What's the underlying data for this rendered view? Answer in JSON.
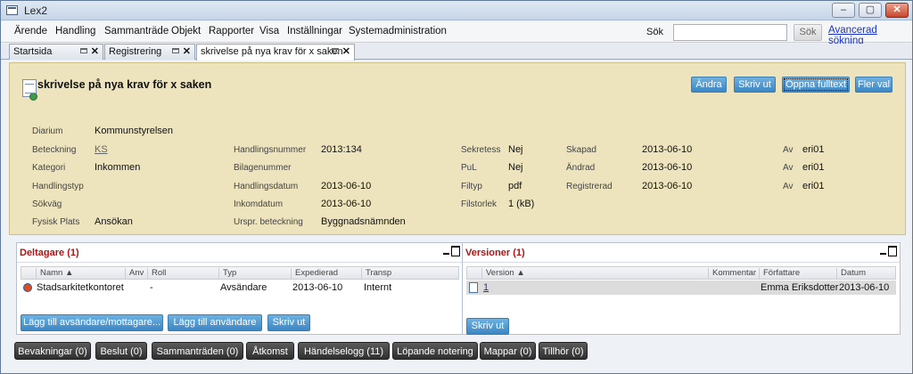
{
  "window": {
    "title": "Lex2"
  },
  "menu": {
    "items": [
      "Ärende",
      "Handling",
      "Sammanträde",
      "Objekt",
      "Rapporter",
      "Visa",
      "Inställningar",
      "Systemadministration"
    ],
    "search_label": "Sök",
    "search_value": "",
    "search_button": "Sök",
    "advanced_search": "Avancerad sökning"
  },
  "tabs": [
    {
      "label": "Startsida"
    },
    {
      "label": "Registrering"
    },
    {
      "label": "skrivelse på nya krav för x saken"
    }
  ],
  "detail": {
    "title": "skrivelse på nya krav för x saken",
    "buttons": {
      "edit": "Ändra",
      "print": "Skriv ut",
      "open_fulltext": "Öppna fulltext",
      "more": "Fler val"
    },
    "fields": {
      "diarium_label": "Diarium",
      "diarium": "Kommunstyrelsen",
      "beteckning_label": "Beteckning",
      "beteckning": "KS",
      "kategori_label": "Kategori",
      "kategori": "Inkommen",
      "handlingstyp_label": "Handlingstyp",
      "handlingstyp": "",
      "sokvag_label": "Sökväg",
      "sokvag": "",
      "fysisk_plats_label": "Fysisk Plats",
      "fysisk_plats": "Ansökan",
      "handlingsnummer_label": "Handlingsnummer",
      "handlingsnummer": "2013:134",
      "bilagenummer_label": "Bilagenummer",
      "bilagenummer": "",
      "handlingsdatum_label": "Handlingsdatum",
      "handlingsdatum": "2013-06-10",
      "inkomdatum_label": "Inkomdatum",
      "inkomdatum": "2013-06-10",
      "urspr_label": "Urspr. beteckning",
      "urspr": "Byggnadsnämnden",
      "sekretess_label": "Sekretess",
      "sekretess": "Nej",
      "pul_label": "PuL",
      "pul": "Nej",
      "filtyp_label": "Filtyp",
      "filtyp": "pdf",
      "filstorlek_label": "Filstorlek",
      "filstorlek": "1 (kB)",
      "skapad_label": "Skapad",
      "skapad": "2013-06-10",
      "andrad_label": "Ändrad",
      "andrad": "2013-06-10",
      "registrerad_label": "Registrerad",
      "registrerad": "2013-06-10",
      "av_label": "Av",
      "av_skapad": "eri01",
      "av_andrad": "eri01",
      "av_registrerad": "eri01"
    }
  },
  "deltagare": {
    "title": "Deltagare (1)",
    "columns": [
      "Namn",
      "Anv",
      "Roll",
      "Typ",
      "Expedierad",
      "Transp"
    ],
    "rows": [
      {
        "namn": "Stadsarkitetkontoret",
        "anv": "",
        "roll": "-",
        "typ": "Avsändare",
        "expedierad": "2013-06-10",
        "transp": "Internt"
      }
    ],
    "buttons": {
      "add_sender": "Lägg till avsändare/mottagare...",
      "add_user": "Lägg till användare",
      "print": "Skriv ut"
    }
  },
  "versioner": {
    "title": "Versioner (1)",
    "columns": [
      "Version",
      "Kommentar",
      "Författare",
      "Datum"
    ],
    "rows": [
      {
        "version": "1",
        "kommentar": "",
        "forfattare": "Emma Eriksdotter",
        "datum": "2013-06-10"
      }
    ],
    "buttons": {
      "print": "Skriv ut"
    }
  },
  "bottom_tabs": [
    "Bevakningar (0)",
    "Beslut (0)",
    "Sammanträden (0)",
    "Åtkomst",
    "Händelselogg (11)",
    "Löpande notering",
    "Mappar (0)",
    "Tillhör (0)"
  ]
}
